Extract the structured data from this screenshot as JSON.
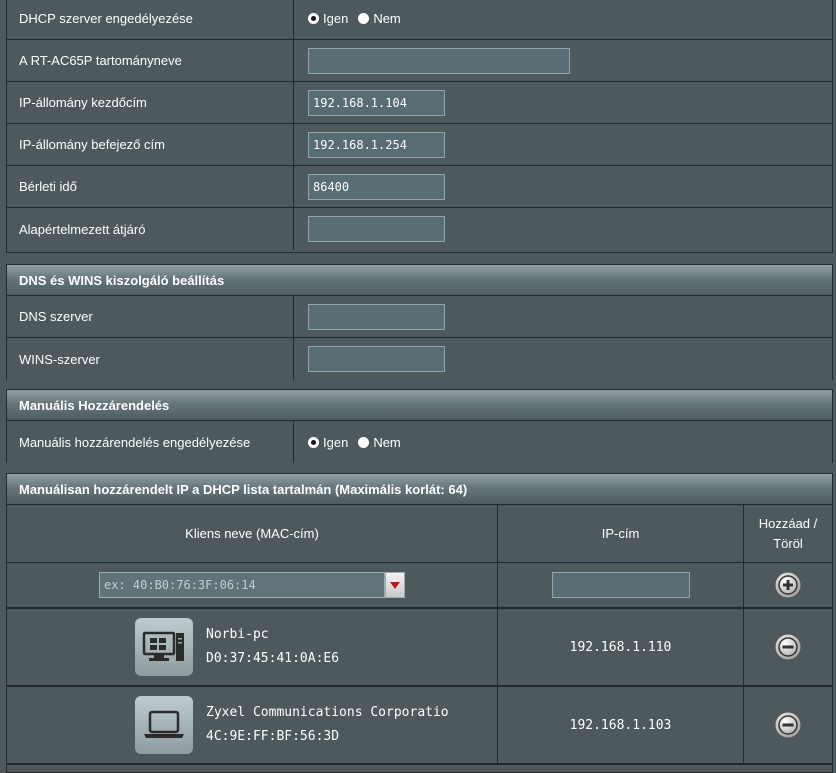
{
  "dhcp": {
    "enable_label": "DHCP szerver engedélyezése",
    "enable_yes": "Igen",
    "enable_no": "Nem",
    "domain_label": "A RT-AC65P tartományneve",
    "domain_value": "",
    "pool_start_label": "IP-állomány kezdőcím",
    "pool_start_value": "192.168.1.104",
    "pool_end_label": "IP-állomány befejező cím",
    "pool_end_value": "192.168.1.254",
    "lease_label": "Bérleti idő",
    "lease_value": "86400",
    "gateway_label": "Alapértelmezett átjáró",
    "gateway_value": ""
  },
  "dns": {
    "title": "DNS és WINS kiszolgáló beállítás",
    "dns_label": "DNS szerver",
    "dns_value": "",
    "wins_label": "WINS-szerver",
    "wins_value": ""
  },
  "manual": {
    "title": "Manuális Hozzárendelés",
    "enable_label": "Manuális hozzárendelés engedélyezése",
    "enable_yes": "Igen",
    "enable_no": "Nem"
  },
  "list": {
    "title": "Manuálisan hozzárendelt IP a DHCP lista tartalmán (Maximális korlát: 64)",
    "col_client": "Kliens neve (MAC-cím)",
    "col_ip": "IP-cím",
    "col_action": "Hozzáad / Töröl",
    "mac_placeholder": "ex: 40:B0:76:3F:06:14",
    "ip_placeholder": "",
    "rows": [
      {
        "name": "Norbi-pc",
        "mac": "D0:37:45:41:0A:E6",
        "ip": "192.168.1.110",
        "icon": "desktop-icon"
      },
      {
        "name": "Zyxel Communications Corporatio",
        "mac": "4C:9E:FF:BF:56:3D",
        "ip": "192.168.1.103",
        "icon": "laptop-icon"
      }
    ]
  }
}
